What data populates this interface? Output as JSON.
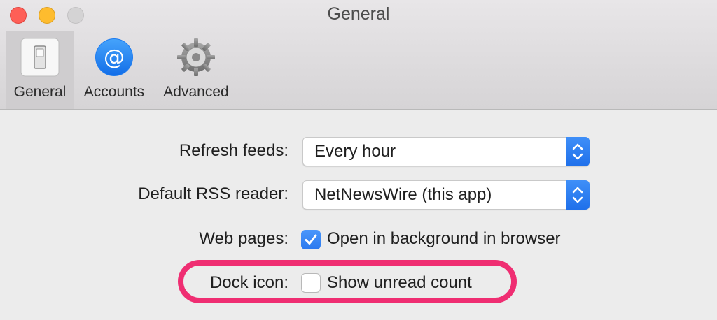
{
  "window": {
    "title": "General"
  },
  "toolbar": {
    "tabs": [
      {
        "label": "General",
        "icon": "general-switch-icon",
        "selected": true
      },
      {
        "label": "Accounts",
        "icon": "at-sign-icon",
        "selected": false
      },
      {
        "label": "Advanced",
        "icon": "gear-icon",
        "selected": false
      }
    ]
  },
  "settings": {
    "refresh_feeds": {
      "label": "Refresh feeds:",
      "value": "Every hour"
    },
    "default_reader": {
      "label": "Default RSS reader:",
      "value": "NetNewsWire (this app)"
    },
    "web_pages": {
      "label": "Web pages:",
      "option": "Open in background in browser",
      "checked": true
    },
    "dock_icon": {
      "label": "Dock icon:",
      "option": "Show unread count",
      "checked": false
    }
  },
  "colors": {
    "accent": "#2b79ef",
    "highlight": "#ef2e72"
  }
}
